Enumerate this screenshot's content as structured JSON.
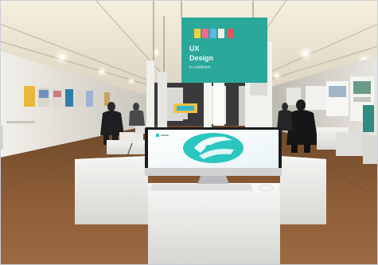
{
  "photo": {
    "alt": "Exhibition hall with an iMac on a white plinth"
  },
  "banner": {
    "title_line1": "UX",
    "title_line2": "Design",
    "subtitle": "in exhibition"
  },
  "monitor": {
    "screen_app": "app-logo"
  },
  "colors": {
    "banner_teal": "#2aa89a",
    "screen_teal": "#2cc6c0",
    "floor_brown": "#8a5a34",
    "ceiling_cream": "#efe7d6"
  }
}
